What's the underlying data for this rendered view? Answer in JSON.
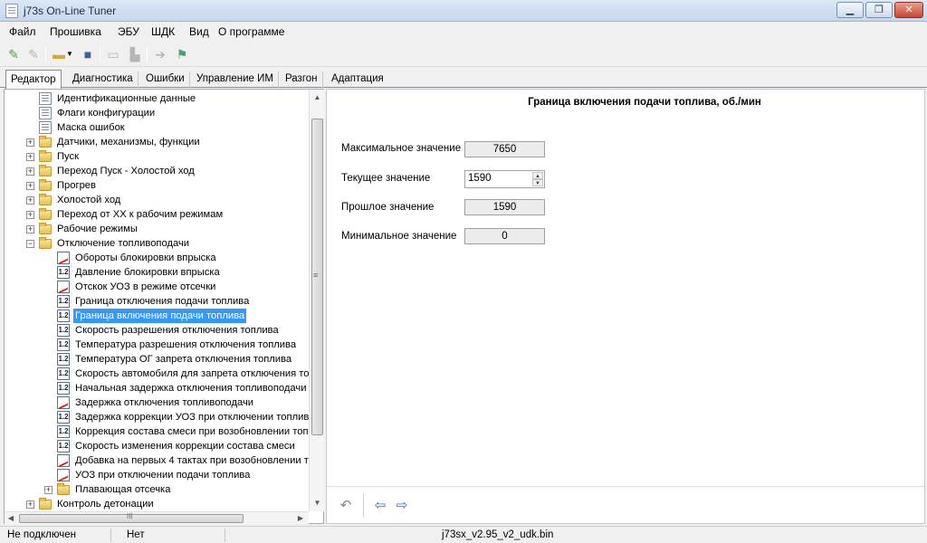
{
  "window": {
    "title": "j73s On-Line Tuner",
    "buttons": {
      "min": "▁",
      "max": "❐",
      "close": "✕"
    }
  },
  "menu": [
    "Файл",
    "Прошивка",
    "ЭБУ",
    "ШДК",
    "Вид",
    "О программе"
  ],
  "toolbar": {
    "icons": [
      "connect-icon",
      "disconnect-icon",
      "open-icon",
      "dropdown-icon",
      "save-icon",
      "ecu-read-icon",
      "ecu-write-icon",
      "arrow-right-icon",
      "flag-icon"
    ]
  },
  "tabs": [
    "Редактор",
    "Диагностика",
    "Ошибки",
    "Управление ИМ",
    "Разгон",
    "Адаптация"
  ],
  "tree": {
    "items": [
      {
        "label": "Идентификационные данные",
        "icon": "doc"
      },
      {
        "label": "Флаги конфигурации",
        "icon": "doc"
      },
      {
        "label": "Маска ошибок",
        "icon": "doc"
      },
      {
        "label": "Датчики, механизмы, функции",
        "icon": "folder",
        "expander": "+"
      },
      {
        "label": "Пуск",
        "icon": "folder",
        "expander": "+"
      },
      {
        "label": "Переход Пуск - Холостой ход",
        "icon": "folder",
        "expander": "+"
      },
      {
        "label": "Прогрев",
        "icon": "folder",
        "expander": "+"
      },
      {
        "label": "Холостой ход",
        "icon": "folder",
        "expander": "+"
      },
      {
        "label": "Переход от ХХ к рабочим режимам",
        "icon": "folder",
        "expander": "+"
      },
      {
        "label": "Рабочие режимы",
        "icon": "folder",
        "expander": "+"
      },
      {
        "label": "Отключение топливоподачи",
        "icon": "folder",
        "expander": "−"
      },
      {
        "label": "Обороты блокировки впрыска",
        "icon": "graph"
      },
      {
        "label": "Давление блокировки впрыска",
        "icon": "num"
      },
      {
        "label": "Отскок УОЗ в режиме отсечки",
        "icon": "graph"
      },
      {
        "label": "Граница отключения подачи топлива",
        "icon": "num"
      },
      {
        "label": "Граница включения подачи топлива",
        "icon": "num",
        "selected": true
      },
      {
        "label": "Скорость разрешения отключения топлива",
        "icon": "num"
      },
      {
        "label": "Температура разрешения отключения топлива",
        "icon": "num"
      },
      {
        "label": "Температура ОГ запрета отключения топлива",
        "icon": "num"
      },
      {
        "label": "Скорость автомобиля для запрета отключения топ",
        "icon": "num"
      },
      {
        "label": "Начальная задержка отключения топливоподачи",
        "icon": "num"
      },
      {
        "label": "Задержка отключения топливоподачи",
        "icon": "graph"
      },
      {
        "label": "Задержка коррекции УОЗ при отключении топлива",
        "icon": "num"
      },
      {
        "label": "Коррекция состава смеси при возобновлении топ",
        "icon": "num"
      },
      {
        "label": "Скорость изменения коррекции состава смеси",
        "icon": "num"
      },
      {
        "label": "Добавка на первых 4 тактах при возобновлении т",
        "icon": "graph"
      },
      {
        "label": "УОЗ при отключении подачи топлива",
        "icon": "graph"
      },
      {
        "label": "Плавающая отсечка",
        "icon": "folder",
        "expander": "+"
      },
      {
        "label": "Контроль детонации",
        "icon": "folder",
        "expander": "+"
      }
    ],
    "num_glyph": "1.2",
    "scroll_glyphs": {
      "up": "▲",
      "down": "▼",
      "left": "◀",
      "right": "▶",
      "grip": "≡",
      "hgrip": "III"
    }
  },
  "param": {
    "title": "Граница включения подачи топлива, об./мин",
    "max_label": "Максимальное значение",
    "max_value": "7650",
    "current_label": "Текущее значение",
    "current_value": "1590",
    "prev_label": "Прошлое значение",
    "prev_value": "1590",
    "min_label": "Минимальное значение",
    "min_value": "0",
    "spin_up": "▲",
    "spin_down": "▼"
  },
  "bottom_tools": {
    "undo": "↶",
    "export": "⇦",
    "import": "⇨"
  },
  "status": {
    "connection": "Не подключен",
    "state": "Нет",
    "file": "j73sx_v2.95_v2_udk.bin"
  }
}
